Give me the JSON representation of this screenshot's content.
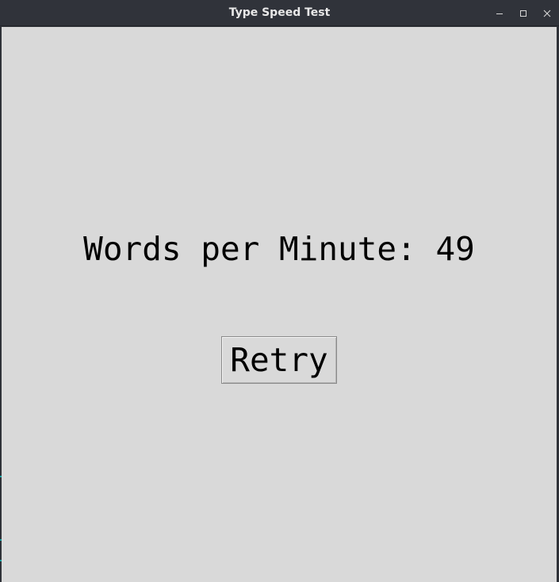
{
  "window": {
    "title": "Type Speed Test"
  },
  "controls": {
    "minimize_icon": "minimize-icon",
    "maximize_icon": "maximize-icon",
    "close_icon": "close-icon"
  },
  "result": {
    "wpm_text": "Words per Minute: 49"
  },
  "actions": {
    "retry_label": "Retry"
  },
  "colors": {
    "titlebar": "#30333a",
    "content_bg": "#d9d9d9",
    "text": "#000000"
  }
}
